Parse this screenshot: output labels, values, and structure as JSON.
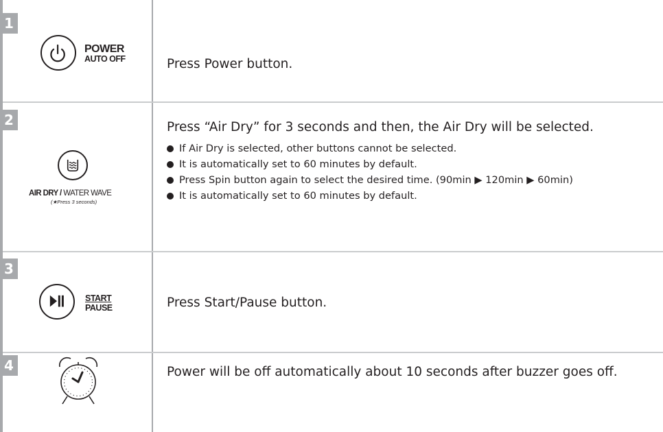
{
  "steps": [
    {
      "number": "1",
      "button_label_line1": "POWER",
      "button_label_line2": "AUTO OFF",
      "instruction": "Press Power button.",
      "icon": "power-icon"
    },
    {
      "number": "2",
      "button_label_bold": "AIR DRY /",
      "button_label_rest": " WATER WAVE",
      "button_note": "(★Press 3 seconds)",
      "instruction": "Press “Air Dry” for 3 seconds and then, the Air Dry will be selected.",
      "icon": "air-dry-icon",
      "bullets": [
        "If Air Dry is selected, other buttons cannot be selected.",
        "It is automatically set to 60 minutes by default.",
        "Press Spin button again to select the desired time. (90min ▶ 120min ▶ 60min)",
        "It is automatically set to 60 minutes by default."
      ]
    },
    {
      "number": "3",
      "button_label_line1": "START",
      "button_label_line2": "PAUSE",
      "instruction": "Press Start/Pause button.",
      "icon": "play-pause-icon"
    },
    {
      "number": "4",
      "instruction": "Power will be off automatically about 10 seconds after buzzer goes off.",
      "icon": "alarm-clock-icon"
    }
  ],
  "colors": {
    "badge": "#a7a9ac",
    "divider": "#c9cbcd",
    "text": "#231f20"
  }
}
